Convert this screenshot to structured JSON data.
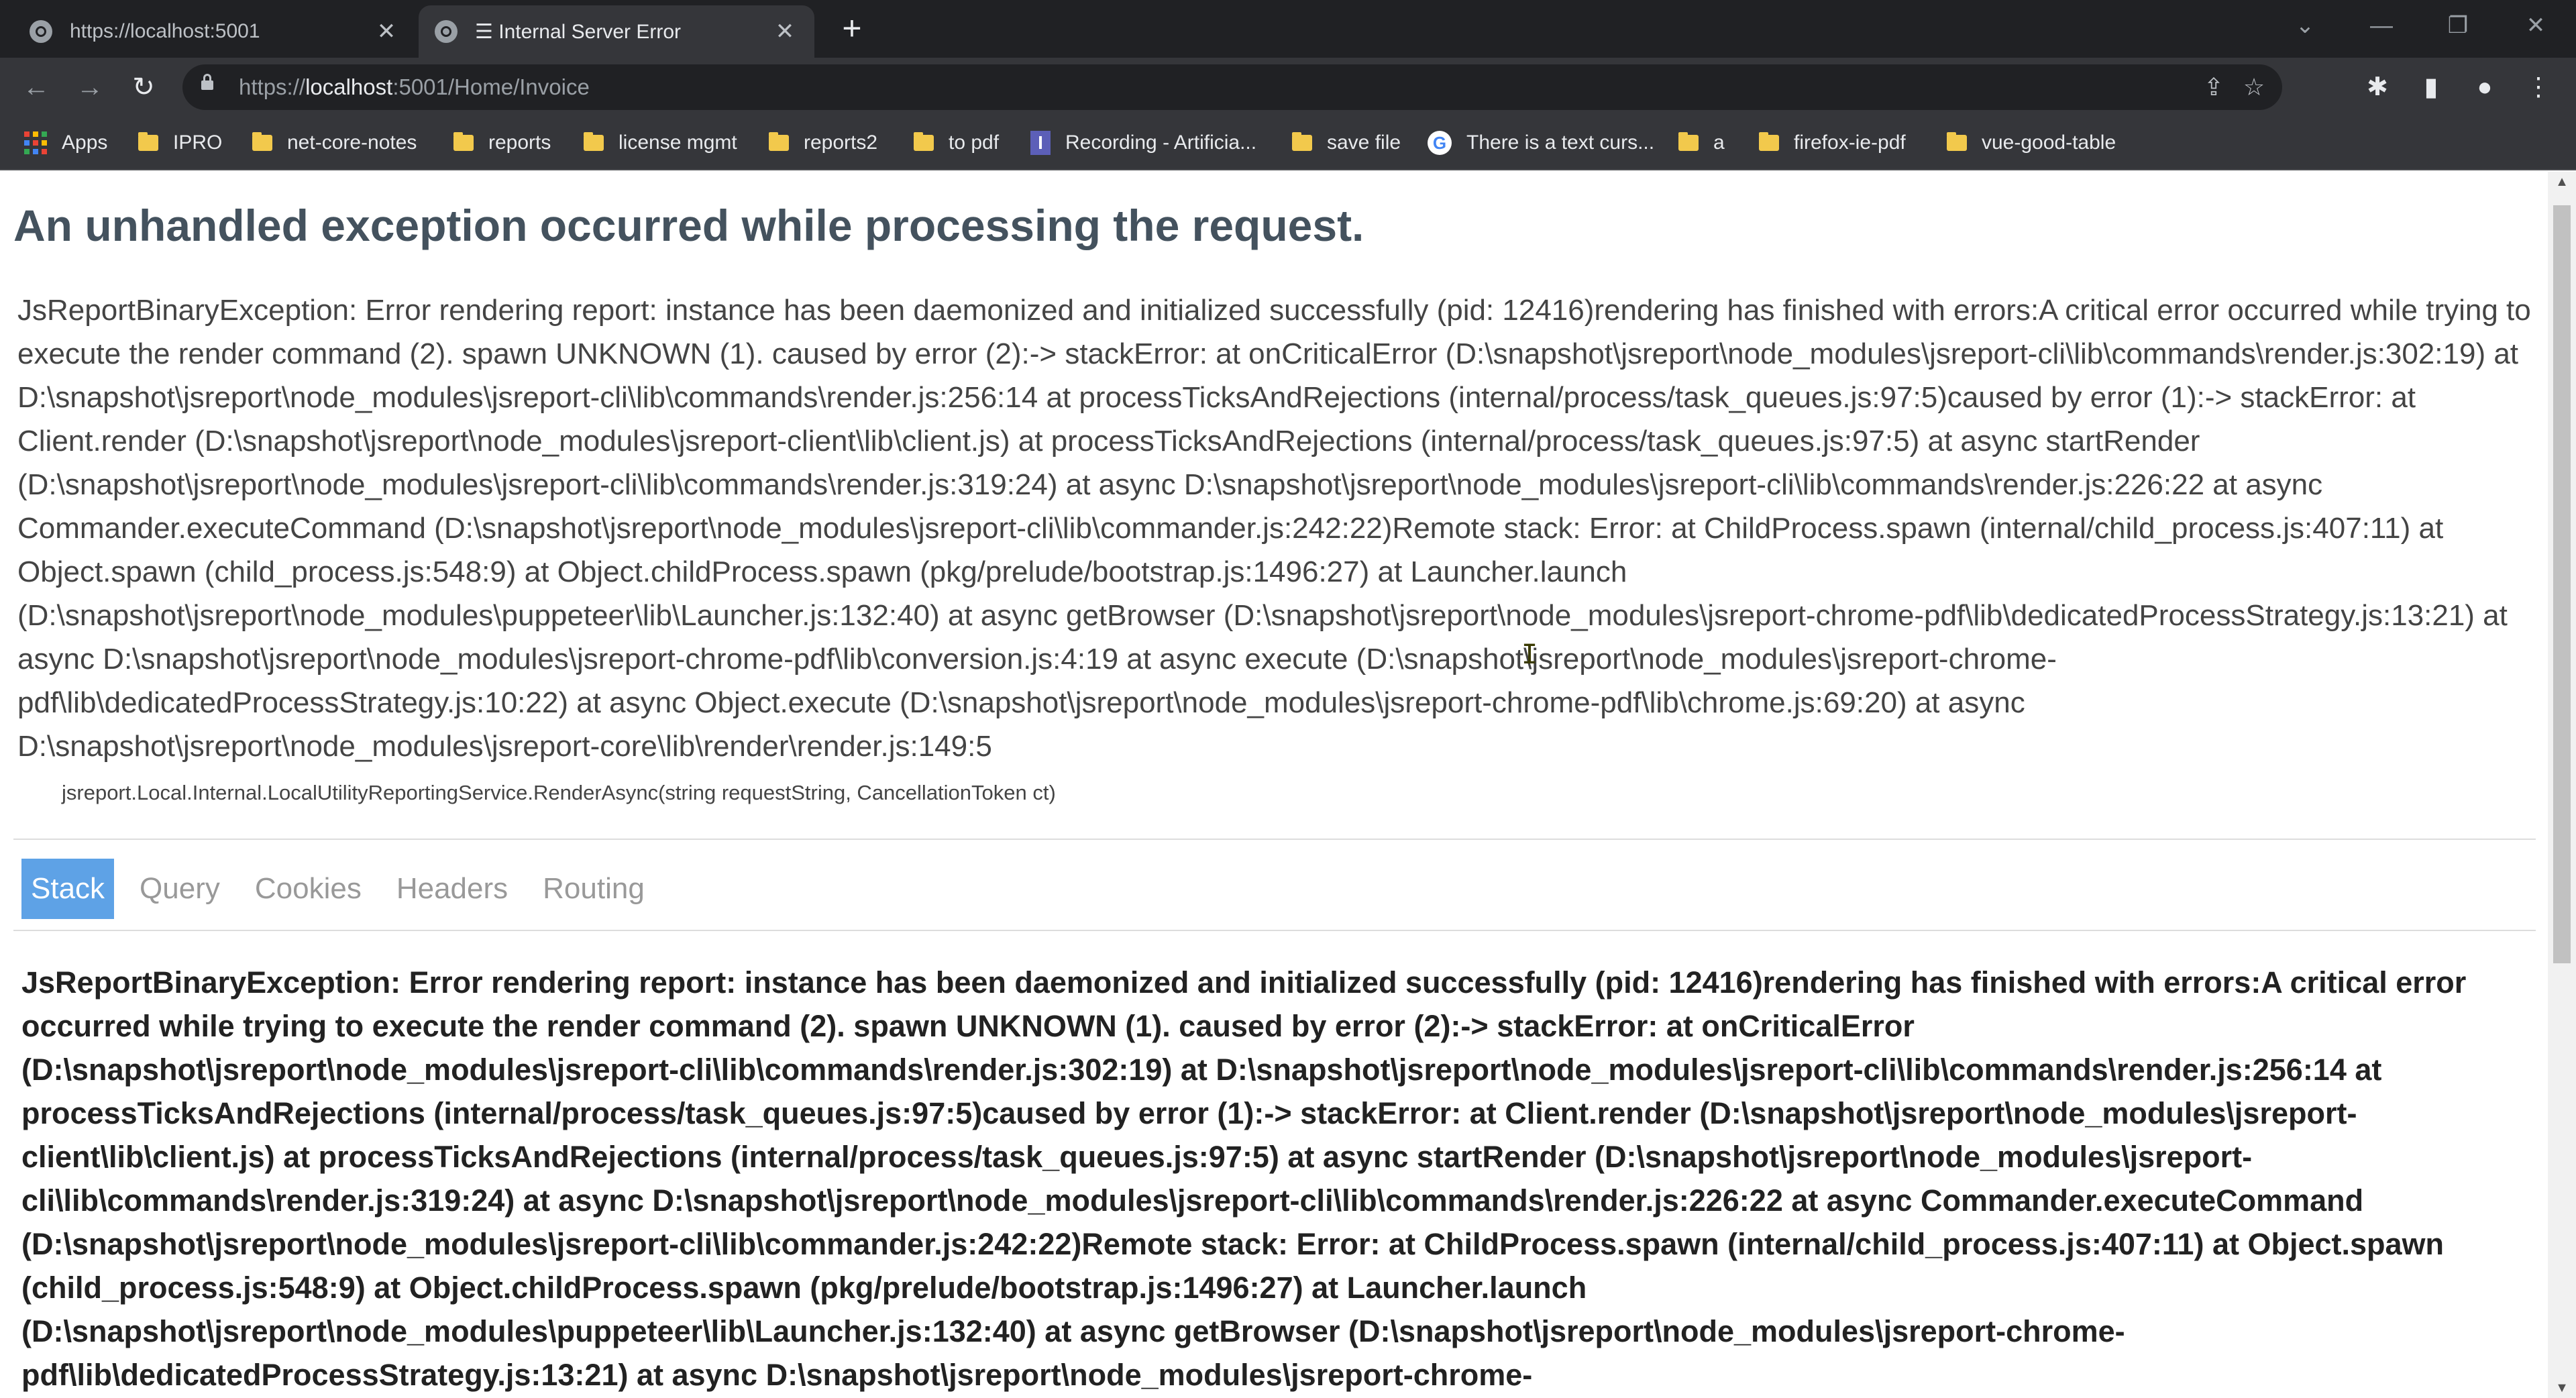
{
  "tabs": [
    {
      "title": "https://localhost:5001",
      "close": "✕"
    },
    {
      "title": "☰ Internal Server Error",
      "close": "✕"
    }
  ],
  "newtab_label": "+",
  "window_controls": {
    "tabsearch": "⌄",
    "minimize": "—",
    "restore": "❐",
    "close": "✕"
  },
  "nav": {
    "back": "←",
    "forward": "→",
    "reload": "↻"
  },
  "address": {
    "scheme": "https://",
    "host": "localhost",
    "rest": ":5001/Home/Invoice"
  },
  "omnibox_icons": {
    "share": "⇪",
    "star": "☆"
  },
  "toolbar_icons": {
    "extensions": "✱",
    "sidepanel": "▮",
    "profile": "●",
    "menu": "⋮"
  },
  "bookmarks": [
    {
      "label": "Apps",
      "icon": "apps-grid"
    },
    {
      "label": "IPRO",
      "icon": "folder"
    },
    {
      "label": "net-core-notes",
      "icon": "folder"
    },
    {
      "label": "reports",
      "icon": "folder"
    },
    {
      "label": "license mgmt",
      "icon": "folder"
    },
    {
      "label": "reports2",
      "icon": "folder"
    },
    {
      "label": "to pdf",
      "icon": "folder"
    },
    {
      "label": "Recording - Artificia...",
      "icon": "recording",
      "icon_glyph": "I"
    },
    {
      "label": "save file",
      "icon": "folder"
    },
    {
      "label": "There is a text curs...",
      "icon": "google",
      "icon_glyph": "G"
    },
    {
      "label": "a",
      "icon": "folder"
    },
    {
      "label": "firefox-ie-pdf",
      "icon": "folder"
    },
    {
      "label": "vue-good-table",
      "icon": "folder"
    }
  ],
  "page": {
    "heading": "An unhandled exception occurred while processing the request.",
    "message": "JsReportBinaryException: Error rendering report: instance has been daemonized and initialized successfully (pid: 12416)rendering has finished with errors:A critical error occurred while trying to execute the render command (2). spawn UNKNOWN (1). caused by error (2):-> stackError: at onCriticalError (D:\\snapshot\\jsreport\\node_modules\\jsreport-cli\\lib\\commands\\render.js:302:19) at D:\\snapshot\\jsreport\\node_modules\\jsreport-cli\\lib\\commands\\render.js:256:14 at processTicksAndRejections (internal/process/task_queues.js:97:5)caused by error (1):-> stackError: at Client.render (D:\\snapshot\\jsreport\\node_modules\\jsreport-client\\lib\\client.js) at processTicksAndRejections (internal/process/task_queues.js:97:5) at async startRender (D:\\snapshot\\jsreport\\node_modules\\jsreport-cli\\lib\\commands\\render.js:319:24) at async D:\\snapshot\\jsreport\\node_modules\\jsreport-cli\\lib\\commands\\render.js:226:22 at async Commander.executeCommand (D:\\snapshot\\jsreport\\node_modules\\jsreport-cli\\lib\\commander.js:242:22)Remote stack: Error: at ChildProcess.spawn (internal/child_process.js:407:11) at Object.spawn (child_process.js:548:9) at Object.childProcess.spawn (pkg/prelude/bootstrap.js:1496:27) at Launcher.launch (D:\\snapshot\\jsreport\\node_modules\\puppeteer\\lib\\Launcher.js:132:40) at async getBrowser (D:\\snapshot\\jsreport\\node_modules\\jsreport-chrome-pdf\\lib\\dedicatedProcessStrategy.js:13:21) at async D:\\snapshot\\jsreport\\node_modules\\jsreport-chrome-pdf\\lib\\conversion.js:4:19 at async execute (D:\\snapshot\\jsreport\\node_modules\\jsreport-chrome-pdf\\lib\\dedicatedProcessStrategy.js:10:22) at async Object.execute (D:\\snapshot\\jsreport\\node_modules\\jsreport-chrome-pdf\\lib\\chrome.js:69:20) at async D:\\snapshot\\jsreport\\node_modules\\jsreport-core\\lib\\render\\render.js:149:5",
    "location": "jsreport.Local.Internal.LocalUtilityReportingService.RenderAsync(string requestString, CancellationToken ct)",
    "tabs": [
      "Stack",
      "Query",
      "Cookies",
      "Headers",
      "Routing"
    ],
    "selected_tab": "Stack",
    "stack_text": "JsReportBinaryException: Error rendering report: instance has been daemonized and initialized successfully (pid: 12416)rendering has finished with errors:A critical error occurred while trying to execute the render command (2). spawn UNKNOWN (1). caused by error (2):-> stackError: at onCriticalError (D:\\snapshot\\jsreport\\node_modules\\jsreport-cli\\lib\\commands\\render.js:302:19) at D:\\snapshot\\jsreport\\node_modules\\jsreport-cli\\lib\\commands\\render.js:256:14 at processTicksAndRejections (internal/process/task_queues.js:97:5)caused by error (1):-> stackError: at Client.render (D:\\snapshot\\jsreport\\node_modules\\jsreport-client\\lib\\client.js) at processTicksAndRejections (internal/process/task_queues.js:97:5) at async startRender (D:\\snapshot\\jsreport\\node_modules\\jsreport-cli\\lib\\commands\\render.js:319:24) at async D:\\snapshot\\jsreport\\node_modules\\jsreport-cli\\lib\\commands\\render.js:226:22 at async Commander.executeCommand (D:\\snapshot\\jsreport\\node_modules\\jsreport-cli\\lib\\commander.js:242:22)Remote stack: Error: at ChildProcess.spawn (internal/child_process.js:407:11) at Object.spawn (child_process.js:548:9) at Object.childProcess.spawn (pkg/prelude/bootstrap.js:1496:27) at Launcher.launch (D:\\snapshot\\jsreport\\node_modules\\puppeteer\\lib\\Launcher.js:132:40) at async getBrowser (D:\\snapshot\\jsreport\\node_modules\\jsreport-chrome-pdf\\lib\\dedicatedProcessStrategy.js:13:21) at async D:\\snapshot\\jsreport\\node_modules\\jsreport-chrome-"
  },
  "scrollbar": {
    "up": "▲",
    "down": "▼"
  },
  "text_cursor_glyph": "I",
  "colors": {
    "tab_selected": "#5ea2e6",
    "heading": "#44525e",
    "folder": "#f2c94c",
    "chrome_dark": "#202124",
    "chrome_toolbar": "#35363a"
  }
}
